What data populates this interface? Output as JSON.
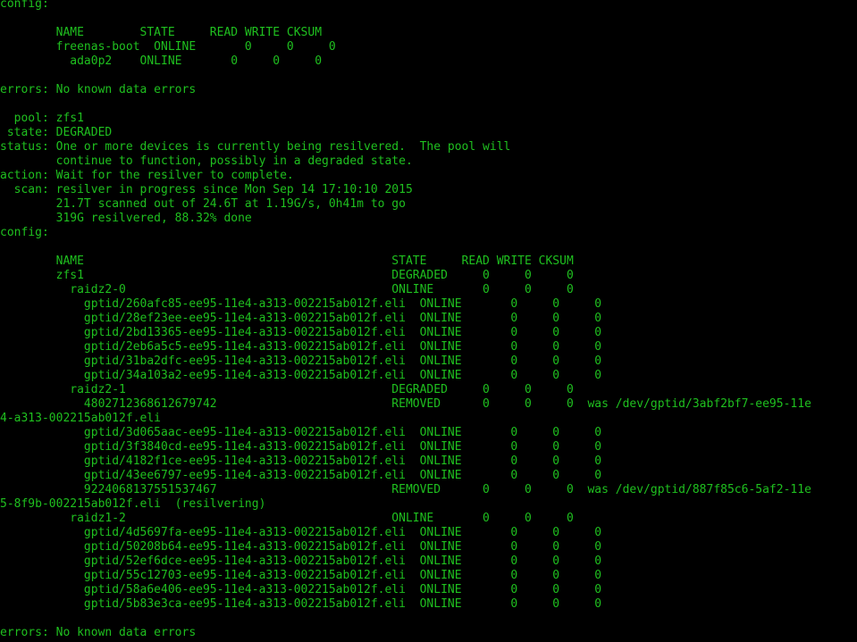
{
  "terminal": {
    "lines": [
      "config:",
      "",
      "        NAME        STATE     READ WRITE CKSUM",
      "        freenas-boot  ONLINE       0     0     0",
      "          ada0p2    ONLINE       0     0     0",
      "",
      "errors: No known data errors",
      "",
      "  pool: zfs1",
      " state: DEGRADED",
      "status: One or more devices is currently being resilvered.  The pool will",
      "        continue to function, possibly in a degraded state.",
      "action: Wait for the resilver to complete.",
      "  scan: resilver in progress since Mon Sep 14 17:10:10 2015",
      "        21.7T scanned out of 24.6T at 1.19G/s, 0h41m to go",
      "        319G resilvered, 88.32% done",
      "config:",
      "",
      "        NAME                                            STATE     READ WRITE CKSUM",
      "        zfs1                                            DEGRADED     0     0     0",
      "          raidz2-0                                      ONLINE       0     0     0",
      "            gptid/260afc85-ee95-11e4-a313-002215ab012f.eli  ONLINE       0     0     0",
      "            gptid/28ef23ee-ee95-11e4-a313-002215ab012f.eli  ONLINE       0     0     0",
      "            gptid/2bd13365-ee95-11e4-a313-002215ab012f.eli  ONLINE       0     0     0",
      "            gptid/2eb6a5c5-ee95-11e4-a313-002215ab012f.eli  ONLINE       0     0     0",
      "            gptid/31ba2dfc-ee95-11e4-a313-002215ab012f.eli  ONLINE       0     0     0",
      "            gptid/34a103a2-ee95-11e4-a313-002215ab012f.eli  ONLINE       0     0     0",
      "          raidz2-1                                      DEGRADED     0     0     0",
      "            4802712368612679742                         REMOVED      0     0     0  was /dev/gptid/3abf2bf7-ee95-11e",
      "4-a313-002215ab012f.eli",
      "            gptid/3d065aac-ee95-11e4-a313-002215ab012f.eli  ONLINE       0     0     0",
      "            gptid/3f3840cd-ee95-11e4-a313-002215ab012f.eli  ONLINE       0     0     0",
      "            gptid/4182f1ce-ee95-11e4-a313-002215ab012f.eli  ONLINE       0     0     0",
      "            gptid/43ee6797-ee95-11e4-a313-002215ab012f.eli  ONLINE       0     0     0",
      "            9224068137551537467                         REMOVED      0     0     0  was /dev/gptid/887f85c6-5af2-11e",
      "5-8f9b-002215ab012f.eli  (resilvering)",
      "          raidz1-2                                      ONLINE       0     0     0",
      "            gptid/4d5697fa-ee95-11e4-a313-002215ab012f.eli  ONLINE       0     0     0",
      "            gptid/50208b64-ee95-11e4-a313-002215ab012f.eli  ONLINE       0     0     0",
      "            gptid/52ef6dce-ee95-11e4-a313-002215ab012f.eli  ONLINE       0     0     0",
      "            gptid/55c12703-ee95-11e4-a313-002215ab012f.eli  ONLINE       0     0     0",
      "            gptid/58a6e406-ee95-11e4-a313-002215ab012f.eli  ONLINE       0     0     0",
      "            gptid/5b83e3ca-ee95-11e4-a313-002215ab012f.eli  ONLINE       0     0     0",
      "",
      "errors: No known data errors"
    ]
  },
  "colors": {
    "background": "#000000",
    "foreground": "#1fc01f"
  }
}
